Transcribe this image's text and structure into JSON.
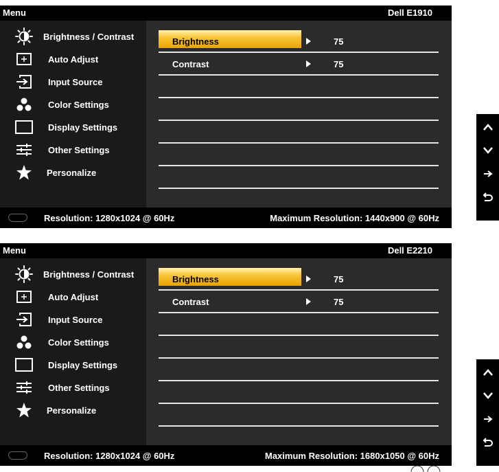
{
  "panels": [
    {
      "menu_title": "Menu",
      "model": "Dell  E1910",
      "menu_items": [
        {
          "label": "Brightness / Contrast",
          "icon": "brightness-icon"
        },
        {
          "label": "Auto Adjust",
          "icon": "auto-adjust-icon"
        },
        {
          "label": "Input Source",
          "icon": "input-source-icon"
        },
        {
          "label": "Color Settings",
          "icon": "color-settings-icon"
        },
        {
          "label": "Display Settings",
          "icon": "display-settings-icon"
        },
        {
          "label": "Other Settings",
          "icon": "other-settings-icon"
        },
        {
          "label": "Personalize",
          "icon": "personalize-icon"
        }
      ],
      "submenu": [
        {
          "label": "Brightness",
          "value": "75",
          "selected": true
        },
        {
          "label": "Contrast",
          "value": "75",
          "selected": false
        }
      ],
      "resolution": "Resolution: 1280x1024 @ 60Hz",
      "max_resolution": "Maximum Resolution: 1440x900 @ 60Hz"
    },
    {
      "menu_title": "Menu",
      "model": "Dell  E2210",
      "menu_items": [
        {
          "label": "Brightness / Contrast",
          "icon": "brightness-icon"
        },
        {
          "label": "Auto Adjust",
          "icon": "auto-adjust-icon"
        },
        {
          "label": "Input Source",
          "icon": "input-source-icon"
        },
        {
          "label": "Color Settings",
          "icon": "color-settings-icon"
        },
        {
          "label": "Display Settings",
          "icon": "display-settings-icon"
        },
        {
          "label": "Other Settings",
          "icon": "other-settings-icon"
        },
        {
          "label": "Personalize",
          "icon": "personalize-icon"
        }
      ],
      "submenu": [
        {
          "label": "Brightness",
          "value": "75",
          "selected": true
        },
        {
          "label": "Contrast",
          "value": "75",
          "selected": false
        }
      ],
      "resolution": "Resolution: 1280x1024 @ 60Hz",
      "max_resolution": "Maximum Resolution: 1680x1050 @ 60Hz"
    }
  ],
  "button_strip": [
    "up-arrow-icon",
    "down-arrow-icon",
    "right-arrow-icon",
    "back-icon"
  ],
  "colors": {
    "highlight": "#f8c63a",
    "left_panel": "#1a1a1a",
    "right_panel": "#2b2b2b",
    "bar": "#000000",
    "text": "#ffffff"
  }
}
